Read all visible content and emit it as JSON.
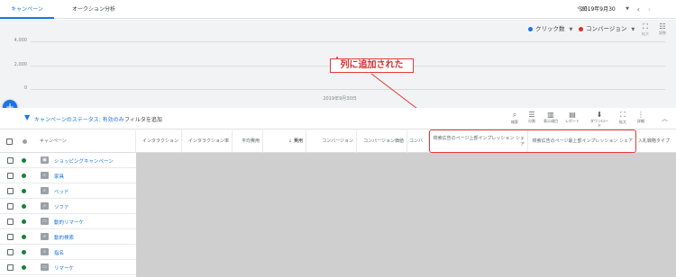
{
  "tabs": [
    {
      "label": "キャンペーン",
      "active": true
    },
    {
      "label": "オークション分析",
      "active": false
    }
  ],
  "date": {
    "label": "今日",
    "value": "2019年9月30日"
  },
  "chart_controls": {
    "metric1": {
      "label": "クリック数",
      "color": "#1a73e8"
    },
    "metric2": {
      "label": "コンバージョン",
      "color": "#d93025"
    },
    "expand_label": "拡大",
    "adjust_label": "調整"
  },
  "chart_data": {
    "type": "line",
    "x": [
      "2019年9月30日"
    ],
    "series": [
      {
        "values": [
          null
        ]
      },
      {
        "values": [
          2100
        ]
      }
    ],
    "ylim": [
      0,
      4000
    ],
    "yticks": [
      "4,000",
      "2,000",
      "0"
    ],
    "grid": true
  },
  "annotation": {
    "text": "列に追加された"
  },
  "filter": {
    "status_text": "キャンペーンのステータス: 有効のみ",
    "add_text": "フィルタを追加"
  },
  "toolbar": {
    "search": "検索",
    "segment": "分割",
    "columns": "表示項目",
    "report": "レポート",
    "download": "ダウンロード",
    "expand": "拡大",
    "more": "詳細"
  },
  "columns": {
    "campaign": "キャンペーン",
    "interactions": "インタラクション",
    "interaction_rate": "インタラクション率",
    "avg_cost": "平均費用",
    "cost": "費用",
    "conversions": "コンバージョン",
    "conv_value": "コンバージョン価値",
    "conv_short": "コンバ",
    "top_is": "検索広告のページ上部インプレッション シェア",
    "abs_top_is": "検索広告のページ最上部インプレッション シェア",
    "bid_type": "入札戦略タイプ",
    "sort_indicator": "↓"
  },
  "rows": [
    {
      "name": "ショッピングキャンペーン",
      "icon": "shopping-icon"
    },
    {
      "name": "家具",
      "icon": "search-icon"
    },
    {
      "name": "ベッド",
      "icon": "search-icon"
    },
    {
      "name": "ソファ",
      "icon": "search-icon"
    },
    {
      "name": "動的リマーケ",
      "icon": "display-icon"
    },
    {
      "name": "動的検索",
      "icon": "search-icon"
    },
    {
      "name": "指名",
      "icon": "search-icon"
    },
    {
      "name": "リマーケ",
      "icon": "display-icon"
    }
  ]
}
